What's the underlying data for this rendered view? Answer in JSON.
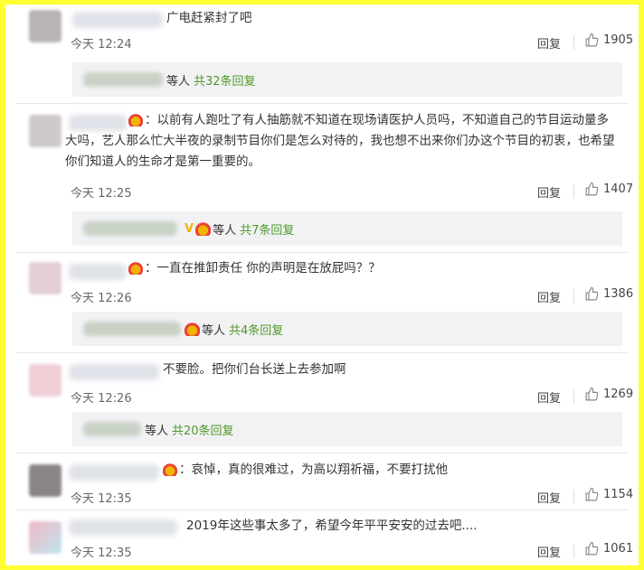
{
  "comments": [
    {
      "text": "广电赶紧封了吧",
      "time": "今天 12:24",
      "reply": "回复",
      "likes": "1905"
    },
    {
      "text": "以前有人跑吐了有人抽筋就不知道在现场请医护人员吗，不知道自己的节目运动量多大吗，艺人那么忙大半夜的录制节目你们是怎么对待的，我也想不出来你们办这个节目的初衷，也希望你们知道人的生命才是第一重要的。",
      "time": "今天 12:25",
      "reply": "回复",
      "likes": "1407"
    },
    {
      "text": "一直在推卸责任 你的声明是在放屁吗？？",
      "time": "今天 12:26",
      "reply": "回复",
      "likes": "1386"
    },
    {
      "text": "不要脸。把你们台长送上去参加啊",
      "time": "今天 12:26",
      "reply": "回复",
      "likes": "1269"
    },
    {
      "text": "哀悼，真的很难过，为高以翔祈福，不要打扰他",
      "time": "今天 12:35",
      "reply": "回复",
      "likes": "1154"
    },
    {
      "text": "2019年这些事太多了，希望今年平平安安的过去吧....",
      "time": "今天 12:35",
      "reply": "回复",
      "likes": "1061"
    }
  ],
  "subreplies": [
    {
      "suffix": "等人",
      "count": "共32条回复"
    },
    {
      "suffix": "等人",
      "count": "共7条回复",
      "vip": "V"
    },
    {
      "suffix": "等人",
      "count": "共4条回复"
    },
    {
      "suffix": "等人",
      "count": "共20条回复"
    }
  ],
  "colors": {
    "border": "#ffff33",
    "reply_count": "#4f9a28",
    "vip": "#f3b500"
  },
  "icons": {
    "like": "thumbs-up-icon",
    "badge": "fan-face-badge-icon"
  }
}
